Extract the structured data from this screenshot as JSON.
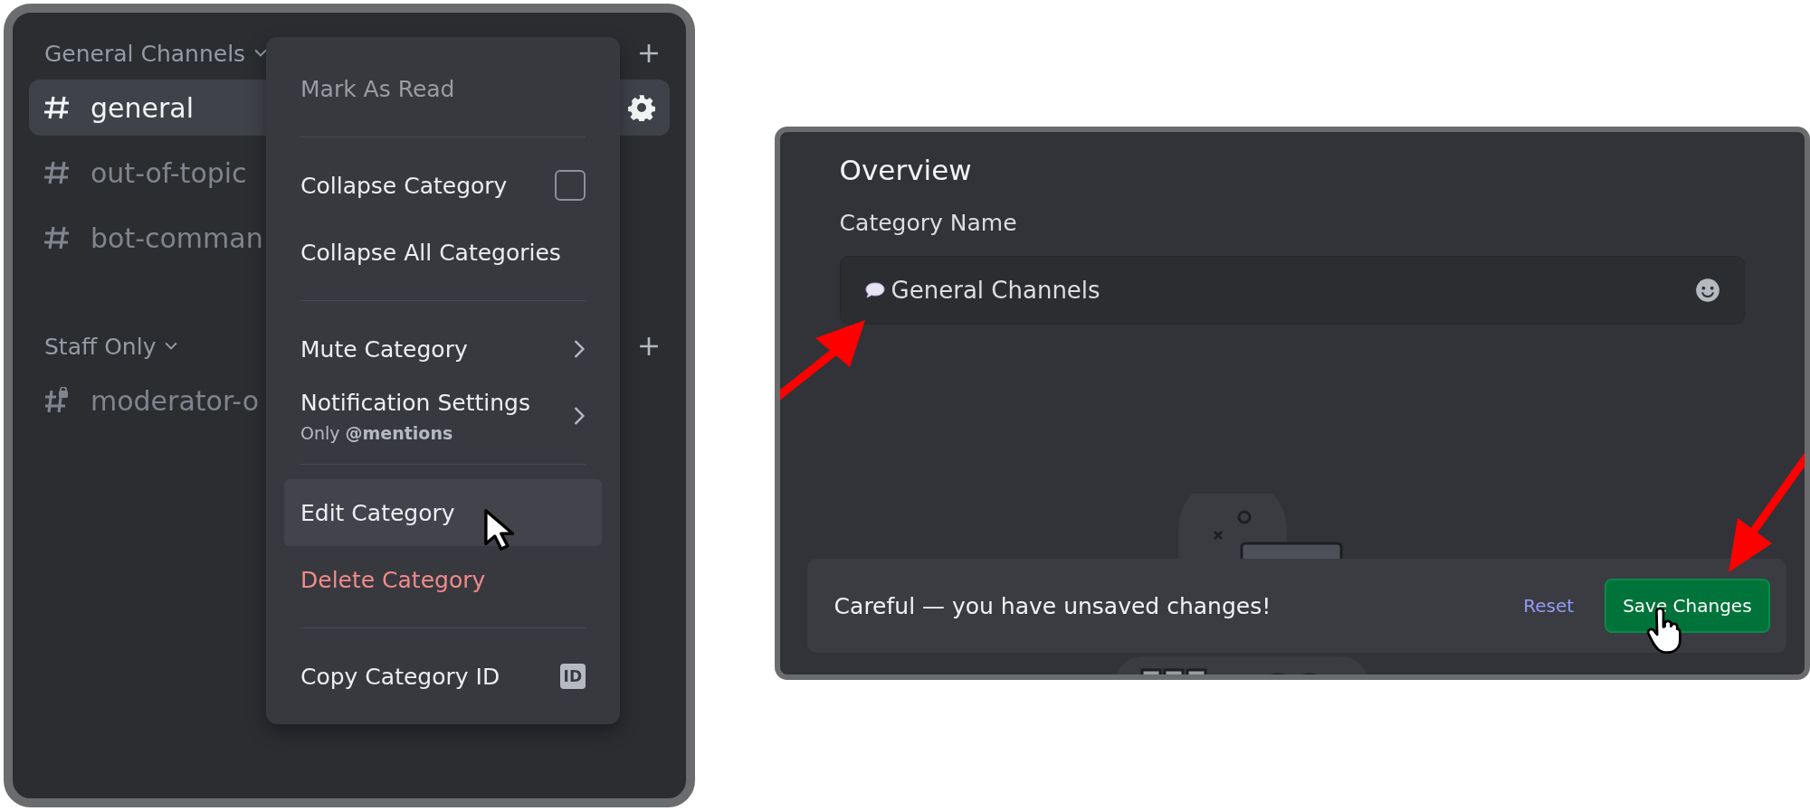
{
  "sidebar": {
    "categories": [
      {
        "name": "General Channels",
        "channels": [
          {
            "name": "general",
            "selected": true,
            "kind": "text"
          },
          {
            "name": "out-of-topic",
            "selected": false,
            "kind": "text"
          },
          {
            "name": "bot-comman",
            "selected": false,
            "kind": "text"
          }
        ]
      },
      {
        "name": "Staff Only",
        "channels": [
          {
            "name": "moderator-o",
            "selected": false,
            "kind": "locked"
          }
        ]
      }
    ]
  },
  "context_menu": {
    "sections": [
      [
        {
          "label": "Mark As Read",
          "kind": "plain",
          "disabled": true,
          "highlighted": false
        }
      ],
      [
        {
          "label": "Collapse Category",
          "kind": "checkbox",
          "checked": false,
          "disabled": false,
          "highlighted": false
        },
        {
          "label": "Collapse All Categories",
          "kind": "plain",
          "disabled": false,
          "highlighted": false
        }
      ],
      [
        {
          "label": "Mute Category",
          "kind": "submenu",
          "disabled": false,
          "highlighted": false
        },
        {
          "label": "Notification Settings",
          "sublabel": "Only **@mentions**",
          "kind": "submenu",
          "disabled": false,
          "highlighted": false
        }
      ],
      [
        {
          "label": "Edit Category",
          "kind": "plain",
          "disabled": false,
          "highlighted": true
        },
        {
          "label": "Delete Category",
          "kind": "danger",
          "disabled": false,
          "highlighted": false
        }
      ],
      [
        {
          "label": "Copy Category ID",
          "kind": "id",
          "badge": "ID",
          "disabled": false,
          "highlighted": false
        }
      ]
    ]
  },
  "settings": {
    "heading": "Overview",
    "field_label": "Category Name",
    "field_value": "General Channels",
    "unsaved_bar": {
      "message": "Careful — you have unsaved changes!",
      "reset": "Reset",
      "save": "Save Changes"
    }
  }
}
